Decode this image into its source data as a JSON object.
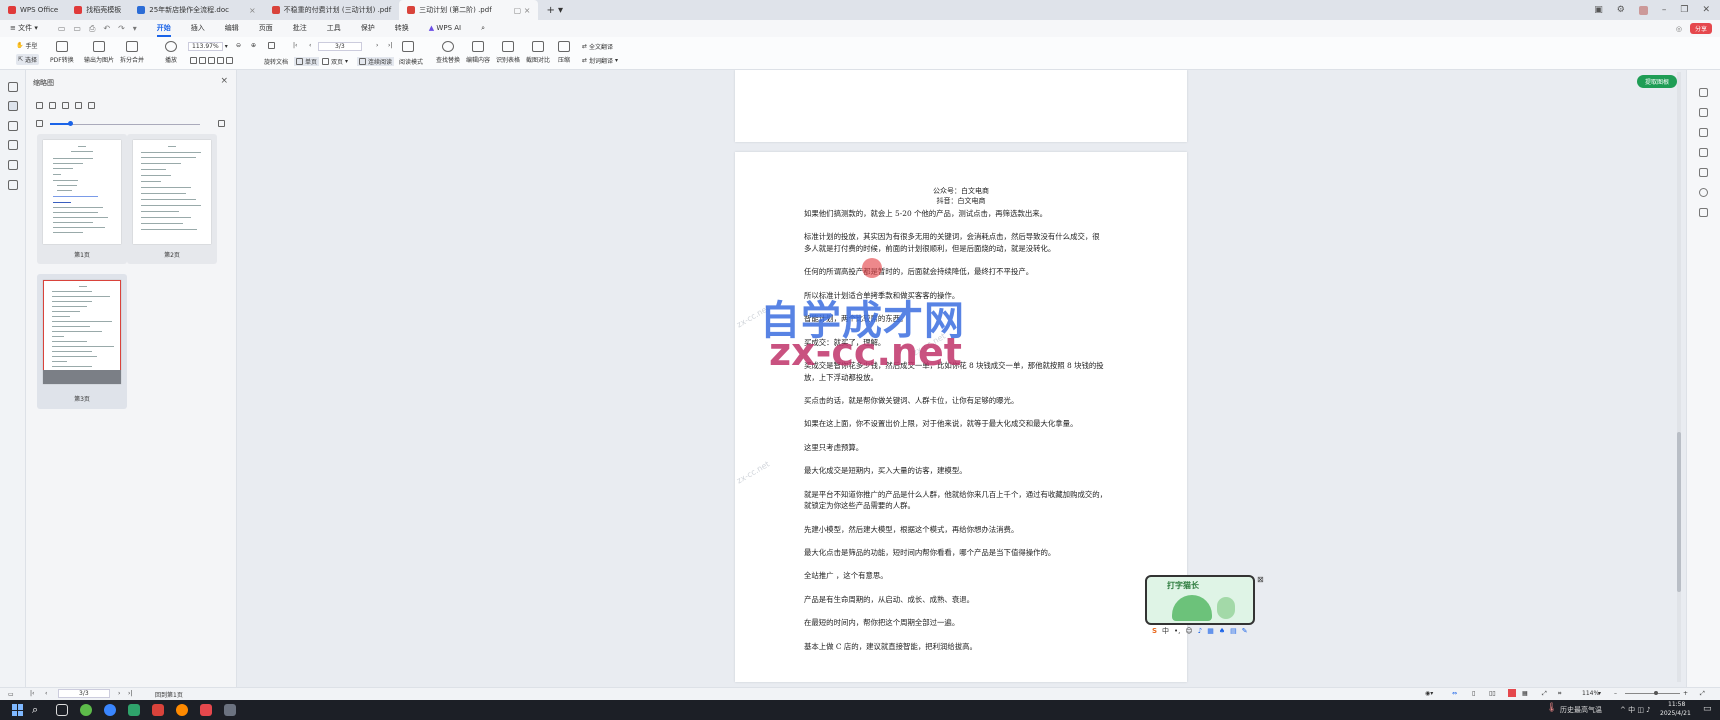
{
  "tabs": [
    {
      "label": "WPS Office",
      "color": "#e03a3a"
    },
    {
      "label": "找稻壳模板",
      "color": "#e03a3a"
    },
    {
      "label": "25年新店操作全流程.doc",
      "color": "#2b6cd6"
    },
    {
      "label": "不稳重的付费计划 (三动计划) .pdf",
      "color": "#d9433b"
    },
    {
      "label": "三动计划 (第二阶) .pdf",
      "color": "#d9433b"
    }
  ],
  "menu": {
    "file": "文件",
    "items": [
      "开始",
      "插入",
      "编辑",
      "页面",
      "批注",
      "工具",
      "保护",
      "转换"
    ],
    "ai": "WPS AI",
    "share": "分享"
  },
  "ribbon": {
    "hand": "手型",
    "select": "选择",
    "pdf_convert": "PDF转换",
    "export_image": "输出为图片",
    "split_merge": "拆分合并",
    "play": "播放",
    "zoom": "113.97%",
    "page_input": "3/3",
    "rotate": "旋转文档",
    "single": "单页",
    "double": "双页",
    "continuous": "连续阅读",
    "read_mode": "阅读模式",
    "find_replace": "查找替换",
    "edit_content": "编辑内容",
    "ocr_table": "识别表格",
    "screenshot_compare": "截图对比",
    "compress": "压缩",
    "full_translate": "全文翻译",
    "translate_sel": "划词翻译"
  },
  "thumbpane": {
    "title": "缩略图",
    "pages": [
      "第1页",
      "第2页",
      "第3页"
    ]
  },
  "green_button": "提取图根",
  "document": {
    "header1": "公众号：白文电商",
    "header2": "抖音：白文电商",
    "paragraphs": [
      [
        "如果他们搞测款的，就会上 5-20 个他的产品，测试点击，再筛选款出来。"
      ],
      [
        "标准计划的投放，其实因为有很多无用的关键词，会消耗点击，然后导致没有什么成交，很",
        "多人就是打付费的时候，前面的计划很顺利，但是后面烧的动，就是没转化。"
      ],
      [
        "任何的所谓高投产都是暂时的，后面就会持续降低，最终打不平投产。"
      ],
      [
        "所以标准计划适合单拷季款和做买客客的操作。"
      ],
      [
        "智能计划，两个比较屌的东西。"
      ],
      [
        "买成交：就买了，理解。"
      ],
      [
        "买成交是智你花多少钱，然后成交一单，比如你花 8 块钱成交一单，那他就按照 8 块钱的投",
        "放，上下浮动都投放。"
      ],
      [
        "买点击的话，就是帮你做关键词、人群卡位，让你有足够的曝光。"
      ],
      [
        "如果在这上面，你不设置出价上限，对于他来说，就等于最大化成交和最大化拿量。"
      ],
      [
        "这里只考虑预算。"
      ],
      [
        "最大化成交是短期内，买入大量的访客，建模型。"
      ],
      [
        "就是平台不知道你推广的产品是什么人群，他就给你来几百上千个，通过有收藏加购成交的，",
        "就锁定为你这些产品需要的人群。"
      ],
      [
        "先建小模型，然后建大模型，根据这个模式，再给你想办法消费。"
      ],
      [
        "最大化点击是筛品的功能，短时间内帮你看看，哪个产品是当下值得操作的。"
      ],
      [
        "全站推广 ，这个有意思。"
      ],
      [
        "产品是有生命周期的，从启动、成长、成熟、衰退。"
      ],
      [
        "在最短的时间内，帮你把这个周期全部过一遍。"
      ],
      [
        "基本上做 C 店的，建议就直接智能，把利润给拔高。"
      ]
    ]
  },
  "watermark": {
    "line1": "自学成才网",
    "line2": "zx-cc.net"
  },
  "statusbar": {
    "page": "3/3",
    "back": "回到第1页",
    "zoom": "114%"
  },
  "taskbar": {
    "weather": "历史最高气温",
    "time": "11:58",
    "date": "2025/4/21"
  },
  "ime": {
    "lang": "中"
  },
  "mascot": {
    "text": "打字猫长"
  }
}
